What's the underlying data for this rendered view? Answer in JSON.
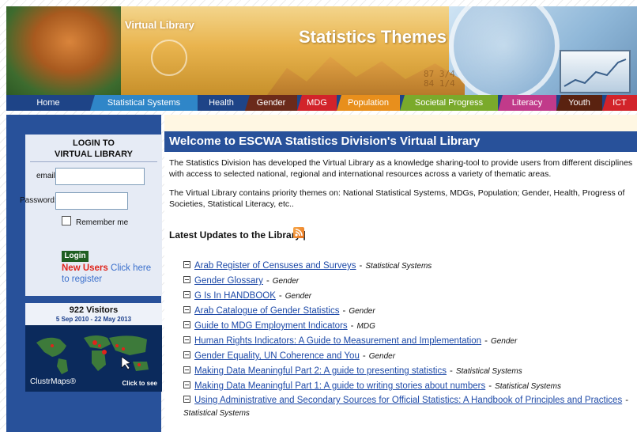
{
  "banner": {
    "virtual_library": "Virtual Library",
    "statistics_themes": "Statistics Themes",
    "digits_1": "87 3/4",
    "digits_2": "84 1/4"
  },
  "tabs": [
    {
      "label": "Home",
      "color": "#1e4487"
    },
    {
      "label": "Statistical Systems",
      "color": "#2f86c8"
    },
    {
      "label": "Health",
      "color": "#1e4487"
    },
    {
      "label": "Gender",
      "color": "#6b2a1a"
    },
    {
      "label": "MDG",
      "color": "#d2232a"
    },
    {
      "label": "Population",
      "color": "#e88f1c"
    },
    {
      "label": "Societal Progress",
      "color": "#7aaa2b"
    },
    {
      "label": "Literacy",
      "color": "#c13a8a"
    },
    {
      "label": "Youth",
      "color": "#5a2210"
    },
    {
      "label": "ICT",
      "color": "#d2232a"
    }
  ],
  "login": {
    "title_line1": "LOGIN TO",
    "title_line2": "VIRTUAL LIBRARY",
    "email_label": "email:",
    "email_value": "",
    "password_label": "Password:",
    "password_value": "",
    "remember_label": "Remember me",
    "button_label": "Login",
    "new_users": "New Users",
    "register_text": "Click here to register"
  },
  "visitors": {
    "count": "922 Visitors",
    "range": "5 Sep 2010 - 22 May 2013",
    "brand": "ClustrMaps®",
    "click": "Click to see"
  },
  "main": {
    "welcome": "Welcome to ESCWA Statistics Division's Virtual Library",
    "para1": "The Statistics Division has developed the Virtual Library as a knowledge sharing-tool to provide users from different disciplines with access to selected national, regional and international resources across a variety of thematic areas.",
    "para2": "The Virtual Library contains priority themes on: National Statistical Systems, MDGs, Population; Gender, Health, Progress of Societies, Statistical Literacy, etc..",
    "latest": "Latest Updates to the Library |"
  },
  "updates": [
    {
      "title": "Arab Register of Censuses and Surveys",
      "category": "Statistical Systems"
    },
    {
      "title": "Gender Glossary",
      "category": "Gender"
    },
    {
      "title": "G Is In HANDBOOK",
      "category": "Gender"
    },
    {
      "title": "Arab Catalogue of Gender Statistics",
      "category": "Gender"
    },
    {
      "title": "Guide to MDG Employment Indicators",
      "category": "MDG"
    },
    {
      "title": "Human Rights Indicators: A Guide to Measurement and Implementation",
      "category": "Gender"
    },
    {
      "title": "Gender Equality, UN Coherence and You",
      "category": "Gender"
    },
    {
      "title": "Making Data Meaningful Part 2: A guide to presenting statistics",
      "category": "Statistical Systems"
    },
    {
      "title": "Making Data Meaningful Part 1: A guide to writing stories about numbers",
      "category": "Statistical Systems"
    },
    {
      "title": "Using Administrative and Secondary Sources for Official Statistics: A Handbook of Principles and Practices",
      "category": "Statistical Systems"
    }
  ],
  "separator": "-"
}
